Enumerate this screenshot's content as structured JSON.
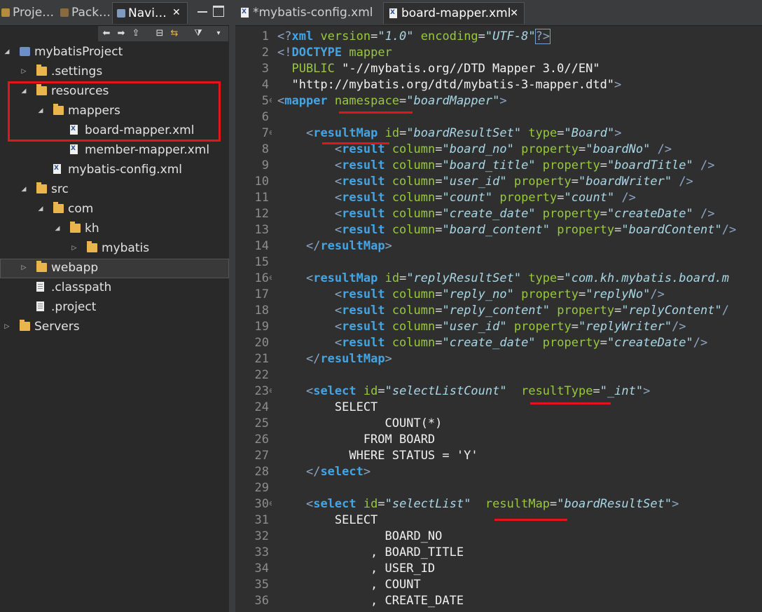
{
  "left_tabs": [
    {
      "label": "Proje…",
      "icon": "project-explorer-icon"
    },
    {
      "label": "Pack…",
      "icon": "package-explorer-icon"
    },
    {
      "label": "Navi…",
      "icon": "navigator-icon",
      "active": true
    }
  ],
  "tree": [
    {
      "label": "mybatisProject",
      "type": "project",
      "depth": 0,
      "expanded": true
    },
    {
      "label": ".settings",
      "type": "folder",
      "depth": 1,
      "expanded": false
    },
    {
      "label": "resources",
      "type": "folder",
      "depth": 1,
      "expanded": true
    },
    {
      "label": "mappers",
      "type": "folder",
      "depth": 2,
      "expanded": true
    },
    {
      "label": "board-mapper.xml",
      "type": "xml",
      "depth": 3
    },
    {
      "label": "member-mapper.xml",
      "type": "xml",
      "depth": 3
    },
    {
      "label": "mybatis-config.xml",
      "type": "xml",
      "depth": 2
    },
    {
      "label": "src",
      "type": "folder",
      "depth": 1,
      "expanded": true
    },
    {
      "label": "com",
      "type": "folder",
      "depth": 2,
      "expanded": true
    },
    {
      "label": "kh",
      "type": "folder",
      "depth": 3,
      "expanded": true
    },
    {
      "label": "mybatis",
      "type": "folder",
      "depth": 4,
      "expanded": false
    },
    {
      "label": "webapp",
      "type": "folder",
      "depth": 1,
      "expanded": false,
      "selected": true
    },
    {
      "label": ".classpath",
      "type": "file",
      "depth": 1
    },
    {
      "label": ".project",
      "type": "file",
      "depth": 1
    },
    {
      "label": "Servers",
      "type": "folder",
      "depth": 0,
      "expanded": false
    }
  ],
  "editor_tabs": [
    {
      "label": "*mybatis-config.xml",
      "active": false
    },
    {
      "label": "board-mapper.xml",
      "active": true
    }
  ],
  "code_lines": [
    {
      "n": "1",
      "fold": false,
      "tokens": [
        [
          "br",
          "<?"
        ],
        [
          "kw2",
          "xml "
        ],
        [
          "at",
          "version"
        ],
        [
          "eq",
          "="
        ],
        [
          "val",
          "\"1.0\""
        ],
        [
          "eq",
          " "
        ],
        [
          "at",
          "encoding"
        ],
        [
          "eq",
          "="
        ],
        [
          "val",
          "\"UTF-8\""
        ],
        [
          "br",
          "?>"
        ]
      ]
    },
    {
      "n": "2",
      "fold": false,
      "tokens": [
        [
          "br",
          "<!"
        ],
        [
          "kw2",
          "DOCTYPE "
        ],
        [
          "doc",
          "mapper"
        ]
      ]
    },
    {
      "n": "3",
      "fold": false,
      "tokens": [
        [
          "doc",
          "  PUBLIC "
        ],
        [
          "str",
          "\"-//mybatis.org//DTD Mapper 3.0//EN\""
        ]
      ]
    },
    {
      "n": "4",
      "fold": false,
      "tokens": [
        [
          "str",
          "  \"http://mybatis.org/dtd/mybatis-3-mapper.dtd\""
        ],
        [
          "br",
          ">"
        ]
      ]
    },
    {
      "n": "5",
      "fold": true,
      "tokens": [
        [
          "br",
          "<"
        ],
        [
          "kw",
          "mapper"
        ],
        [
          "eq",
          " "
        ],
        [
          "at",
          "namespace"
        ],
        [
          "eq",
          "="
        ],
        [
          "val",
          "\"boardMapper\""
        ],
        [
          "br",
          ">"
        ]
      ]
    },
    {
      "n": "6",
      "fold": false,
      "tokens": []
    },
    {
      "n": "7",
      "fold": true,
      "tokens": [
        [
          "eq",
          "    "
        ],
        [
          "br",
          "<"
        ],
        [
          "kw",
          "resultMap"
        ],
        [
          "eq",
          " "
        ],
        [
          "at",
          "id"
        ],
        [
          "eq",
          "="
        ],
        [
          "val",
          "\"boardResultSet\""
        ],
        [
          "eq",
          " "
        ],
        [
          "at",
          "type"
        ],
        [
          "eq",
          "="
        ],
        [
          "val",
          "\"Board\""
        ],
        [
          "br",
          ">"
        ]
      ]
    },
    {
      "n": "8",
      "fold": false,
      "tokens": [
        [
          "eq",
          "        "
        ],
        [
          "br",
          "<"
        ],
        [
          "kw",
          "result"
        ],
        [
          "eq",
          " "
        ],
        [
          "at",
          "column"
        ],
        [
          "eq",
          "="
        ],
        [
          "val",
          "\"board_no\""
        ],
        [
          "eq",
          " "
        ],
        [
          "at",
          "property"
        ],
        [
          "eq",
          "="
        ],
        [
          "val",
          "\"boardNo\""
        ],
        [
          "eq",
          " "
        ],
        [
          "br",
          "/>"
        ]
      ]
    },
    {
      "n": "9",
      "fold": false,
      "tokens": [
        [
          "eq",
          "        "
        ],
        [
          "br",
          "<"
        ],
        [
          "kw",
          "result"
        ],
        [
          "eq",
          " "
        ],
        [
          "at",
          "column"
        ],
        [
          "eq",
          "="
        ],
        [
          "val",
          "\"board_title\""
        ],
        [
          "eq",
          " "
        ],
        [
          "at",
          "property"
        ],
        [
          "eq",
          "="
        ],
        [
          "val",
          "\"boardTitle\""
        ],
        [
          "eq",
          " "
        ],
        [
          "br",
          "/>"
        ]
      ]
    },
    {
      "n": "10",
      "fold": false,
      "tokens": [
        [
          "eq",
          "        "
        ],
        [
          "br",
          "<"
        ],
        [
          "kw",
          "result"
        ],
        [
          "eq",
          " "
        ],
        [
          "at",
          "column"
        ],
        [
          "eq",
          "="
        ],
        [
          "val",
          "\"user_id\""
        ],
        [
          "eq",
          " "
        ],
        [
          "at",
          "property"
        ],
        [
          "eq",
          "="
        ],
        [
          "val",
          "\"boardWriter\""
        ],
        [
          "eq",
          " "
        ],
        [
          "br",
          "/>"
        ]
      ]
    },
    {
      "n": "11",
      "fold": false,
      "tokens": [
        [
          "eq",
          "        "
        ],
        [
          "br",
          "<"
        ],
        [
          "kw",
          "result"
        ],
        [
          "eq",
          " "
        ],
        [
          "at",
          "column"
        ],
        [
          "eq",
          "="
        ],
        [
          "val",
          "\"count\""
        ],
        [
          "eq",
          " "
        ],
        [
          "at",
          "property"
        ],
        [
          "eq",
          "="
        ],
        [
          "val",
          "\"count\""
        ],
        [
          "eq",
          " "
        ],
        [
          "br",
          "/>"
        ]
      ]
    },
    {
      "n": "12",
      "fold": false,
      "tokens": [
        [
          "eq",
          "        "
        ],
        [
          "br",
          "<"
        ],
        [
          "kw",
          "result"
        ],
        [
          "eq",
          " "
        ],
        [
          "at",
          "column"
        ],
        [
          "eq",
          "="
        ],
        [
          "val",
          "\"create_date\""
        ],
        [
          "eq",
          " "
        ],
        [
          "at",
          "property"
        ],
        [
          "eq",
          "="
        ],
        [
          "val",
          "\"createDate\""
        ],
        [
          "eq",
          " "
        ],
        [
          "br",
          "/>"
        ]
      ]
    },
    {
      "n": "13",
      "fold": false,
      "tokens": [
        [
          "eq",
          "        "
        ],
        [
          "br",
          "<"
        ],
        [
          "kw",
          "result"
        ],
        [
          "eq",
          " "
        ],
        [
          "at",
          "column"
        ],
        [
          "eq",
          "="
        ],
        [
          "val",
          "\"board_content\""
        ],
        [
          "eq",
          " "
        ],
        [
          "at",
          "property"
        ],
        [
          "eq",
          "="
        ],
        [
          "val",
          "\"boardContent\""
        ],
        [
          "br",
          "/>"
        ]
      ]
    },
    {
      "n": "14",
      "fold": false,
      "tokens": [
        [
          "eq",
          "    "
        ],
        [
          "br",
          "</"
        ],
        [
          "kw",
          "resultMap"
        ],
        [
          "br",
          ">"
        ]
      ]
    },
    {
      "n": "15",
      "fold": false,
      "tokens": []
    },
    {
      "n": "16",
      "fold": true,
      "tokens": [
        [
          "eq",
          "    "
        ],
        [
          "br",
          "<"
        ],
        [
          "kw",
          "resultMap"
        ],
        [
          "eq",
          " "
        ],
        [
          "at",
          "id"
        ],
        [
          "eq",
          "="
        ],
        [
          "val",
          "\"replyResultSet\""
        ],
        [
          "eq",
          " "
        ],
        [
          "at",
          "type"
        ],
        [
          "eq",
          "="
        ],
        [
          "val",
          "\"com.kh.mybatis.board.m"
        ]
      ]
    },
    {
      "n": "17",
      "fold": false,
      "tokens": [
        [
          "eq",
          "        "
        ],
        [
          "br",
          "<"
        ],
        [
          "kw",
          "result"
        ],
        [
          "eq",
          " "
        ],
        [
          "at",
          "column"
        ],
        [
          "eq",
          "="
        ],
        [
          "val",
          "\"reply_no\""
        ],
        [
          "eq",
          " "
        ],
        [
          "at",
          "property"
        ],
        [
          "eq",
          "="
        ],
        [
          "val",
          "\"replyNo\""
        ],
        [
          "br",
          "/>"
        ]
      ]
    },
    {
      "n": "18",
      "fold": false,
      "tokens": [
        [
          "eq",
          "        "
        ],
        [
          "br",
          "<"
        ],
        [
          "kw",
          "result"
        ],
        [
          "eq",
          " "
        ],
        [
          "at",
          "column"
        ],
        [
          "eq",
          "="
        ],
        [
          "val",
          "\"reply_content\""
        ],
        [
          "eq",
          " "
        ],
        [
          "at",
          "property"
        ],
        [
          "eq",
          "="
        ],
        [
          "val",
          "\"replyContent\""
        ],
        [
          "br",
          "/"
        ]
      ]
    },
    {
      "n": "19",
      "fold": false,
      "tokens": [
        [
          "eq",
          "        "
        ],
        [
          "br",
          "<"
        ],
        [
          "kw",
          "result"
        ],
        [
          "eq",
          " "
        ],
        [
          "at",
          "column"
        ],
        [
          "eq",
          "="
        ],
        [
          "val",
          "\"user_id\""
        ],
        [
          "eq",
          " "
        ],
        [
          "at",
          "property"
        ],
        [
          "eq",
          "="
        ],
        [
          "val",
          "\"replyWriter\""
        ],
        [
          "br",
          "/>"
        ]
      ]
    },
    {
      "n": "20",
      "fold": false,
      "tokens": [
        [
          "eq",
          "        "
        ],
        [
          "br",
          "<"
        ],
        [
          "kw",
          "result"
        ],
        [
          "eq",
          " "
        ],
        [
          "at",
          "column"
        ],
        [
          "eq",
          "="
        ],
        [
          "val",
          "\"create_date\""
        ],
        [
          "eq",
          " "
        ],
        [
          "at",
          "property"
        ],
        [
          "eq",
          "="
        ],
        [
          "val",
          "\"createDate\""
        ],
        [
          "br",
          "/>"
        ]
      ]
    },
    {
      "n": "21",
      "fold": false,
      "tokens": [
        [
          "eq",
          "    "
        ],
        [
          "br",
          "</"
        ],
        [
          "kw",
          "resultMap"
        ],
        [
          "br",
          ">"
        ]
      ]
    },
    {
      "n": "22",
      "fold": false,
      "tokens": []
    },
    {
      "n": "23",
      "fold": true,
      "tokens": [
        [
          "eq",
          "    "
        ],
        [
          "br",
          "<"
        ],
        [
          "kw",
          "select"
        ],
        [
          "eq",
          " "
        ],
        [
          "at",
          "id"
        ],
        [
          "eq",
          "="
        ],
        [
          "val",
          "\"selectListCount\""
        ],
        [
          "eq",
          "  "
        ],
        [
          "at",
          "resultType"
        ],
        [
          "eq",
          "="
        ],
        [
          "val",
          "\"_int\""
        ],
        [
          "br",
          ">"
        ]
      ]
    },
    {
      "n": "24",
      "fold": false,
      "tokens": [
        [
          "sql",
          "        SELECT"
        ]
      ]
    },
    {
      "n": "25",
      "fold": false,
      "tokens": [
        [
          "sql",
          "               COUNT(*)"
        ]
      ]
    },
    {
      "n": "26",
      "fold": false,
      "tokens": [
        [
          "sql",
          "            FROM BOARD"
        ]
      ]
    },
    {
      "n": "27",
      "fold": false,
      "tokens": [
        [
          "sql",
          "          WHERE STATUS = 'Y'"
        ]
      ]
    },
    {
      "n": "28",
      "fold": false,
      "tokens": [
        [
          "eq",
          "    "
        ],
        [
          "br",
          "</"
        ],
        [
          "kw",
          "select"
        ],
        [
          "br",
          ">"
        ]
      ]
    },
    {
      "n": "29",
      "fold": false,
      "tokens": []
    },
    {
      "n": "30",
      "fold": true,
      "tokens": [
        [
          "eq",
          "    "
        ],
        [
          "br",
          "<"
        ],
        [
          "kw",
          "select"
        ],
        [
          "eq",
          " "
        ],
        [
          "at",
          "id"
        ],
        [
          "eq",
          "="
        ],
        [
          "val",
          "\"selectList\""
        ],
        [
          "eq",
          "  "
        ],
        [
          "at",
          "resultMap"
        ],
        [
          "eq",
          "="
        ],
        [
          "val",
          "\"boardResultSet\""
        ],
        [
          "br",
          ">"
        ]
      ]
    },
    {
      "n": "31",
      "fold": false,
      "tokens": [
        [
          "sql",
          "        SELECT"
        ]
      ]
    },
    {
      "n": "32",
      "fold": false,
      "tokens": [
        [
          "sql",
          "               BOARD_NO"
        ]
      ]
    },
    {
      "n": "33",
      "fold": false,
      "tokens": [
        [
          "sql",
          "             , BOARD_TITLE"
        ]
      ]
    },
    {
      "n": "34",
      "fold": false,
      "tokens": [
        [
          "sql",
          "             , USER_ID"
        ]
      ]
    },
    {
      "n": "35",
      "fold": false,
      "tokens": [
        [
          "sql",
          "             , COUNT"
        ]
      ]
    },
    {
      "n": "36",
      "fold": false,
      "tokens": [
        [
          "sql",
          "             , CREATE_DATE"
        ]
      ]
    }
  ],
  "colors": {
    "annotation_red": "#e0161c",
    "keyword": "#45a4e3",
    "attribute": "#98c93c",
    "value": "#a8d7e6"
  }
}
